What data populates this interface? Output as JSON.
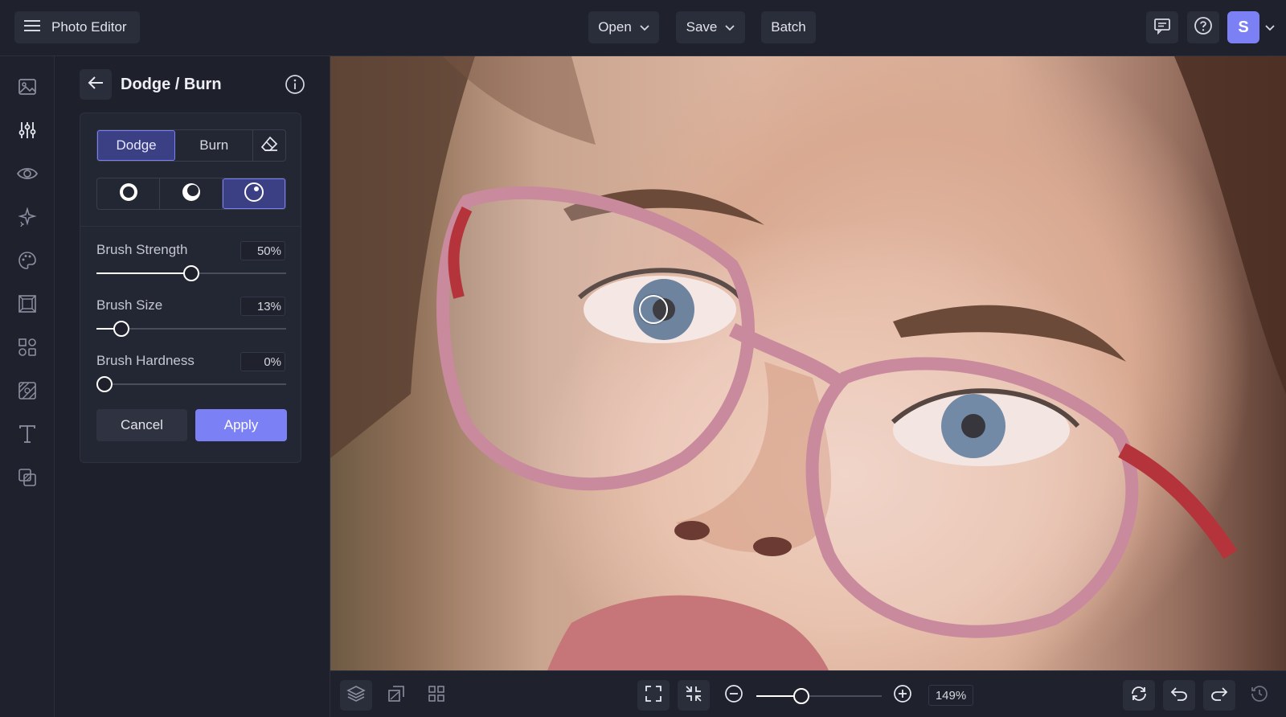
{
  "app": {
    "title": "Photo Editor"
  },
  "header": {
    "open_label": "Open",
    "save_label": "Save",
    "batch_label": "Batch",
    "avatar_initial": "S"
  },
  "rail": {
    "items": [
      "image-icon",
      "sliders-icon",
      "eye-icon",
      "sparkles-icon",
      "palette-icon",
      "frame-icon",
      "shapes-icon",
      "texture-icon",
      "text-icon",
      "layers-overlay-icon"
    ]
  },
  "panel": {
    "title": "Dodge / Burn",
    "modes": [
      "Dodge",
      "Burn"
    ],
    "active_mode": "Dodge",
    "range_icons": [
      "shadows-circle-icon",
      "midtones-circle-icon",
      "highlights-circle-icon"
    ],
    "active_range_index": 2,
    "sliders": [
      {
        "label": "Brush Strength",
        "value_text": "50%",
        "value": 50
      },
      {
        "label": "Brush Size",
        "value_text": "13%",
        "value": 13
      },
      {
        "label": "Brush Hardness",
        "value_text": "0%",
        "value": 0
      }
    ],
    "cancel_label": "Cancel",
    "apply_label": "Apply"
  },
  "canvas": {
    "image_alt": "Close-up portrait of a person wearing pink glasses"
  },
  "footer": {
    "zoom_text": "149%",
    "zoom_slider_fraction": 0.36
  },
  "colors": {
    "accent": "#7c80f5",
    "background": "#1e202b",
    "panel": "#232633"
  }
}
